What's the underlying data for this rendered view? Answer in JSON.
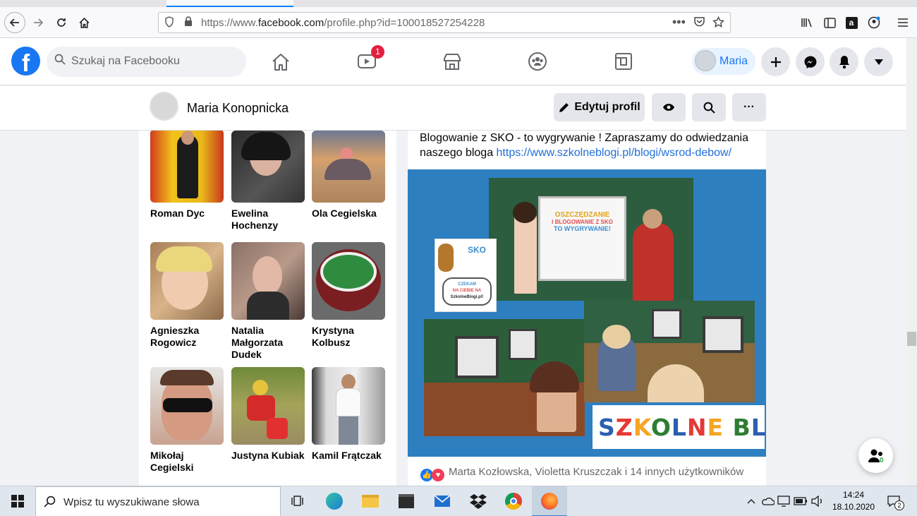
{
  "browser": {
    "url_prefix": "https://www.",
    "url_domain": "facebook.com",
    "url_path": "/profile.php?id=100018527254228"
  },
  "facebook": {
    "search_placeholder": "Szukaj na Facebooku",
    "watch_badge": "1",
    "user_chip_name": "Maria"
  },
  "profile_header": {
    "name": "Maria Konopnicka",
    "edit_profile_label": "Edytuj profil",
    "more_label": "···"
  },
  "friends": [
    {
      "name": "Roman Dyc",
      "color": "#d9a21a"
    },
    {
      "name": "Ewelina Hochenzy",
      "color": "#3b3b3b"
    },
    {
      "name": "Ola Cegielska",
      "color": "#c9a27a"
    },
    {
      "name": "Agnieszka Rogowicz",
      "color": "#caa57a"
    },
    {
      "name": "Natalia Małgorzata Dudek",
      "color": "#6a5a55"
    },
    {
      "name": "Krystyna Kolbusz",
      "color": "#8a3b3b"
    },
    {
      "name": "Mikołaj Cegielski",
      "color": "#c89a86"
    },
    {
      "name": "Justyna Kubiak",
      "color": "#8c9a4a"
    },
    {
      "name": "Kamil Frątczak",
      "color": "#b8b8b8"
    }
  ],
  "post": {
    "text_line1": "Blogowanie z SKO - to wygrywanie ! Zapraszamy do odwiedzania",
    "text_line2_prefix": "naszego bloga ",
    "link": "https://www.szkolneblogi.pl/blogi/wsrod-debow/",
    "image": {
      "slide_title_1": "OSZCZĘDZANIE",
      "slide_title_2": "I BLOGOWANIE Z SKO",
      "slide_title_3": "TO WYGRYWANIE!",
      "badge_sko": "SKO",
      "bubble_text_1": "CZEKAM",
      "bubble_text_2": "NA CIEBIE NA",
      "bubble_text_3": "SzkolneBlogi.pl!",
      "logo_text": "SZKOLNE BLOGI"
    },
    "reactions_text": "Marta Kozłowska, Violetta Kruszczak i 14 innych użytkowników"
  },
  "chat": {
    "count": "0"
  },
  "taskbar": {
    "search_placeholder": "Wpisz tu wyszukiwane słowa",
    "time": "14:24",
    "date": "18.10.2020",
    "notifications": "2"
  }
}
